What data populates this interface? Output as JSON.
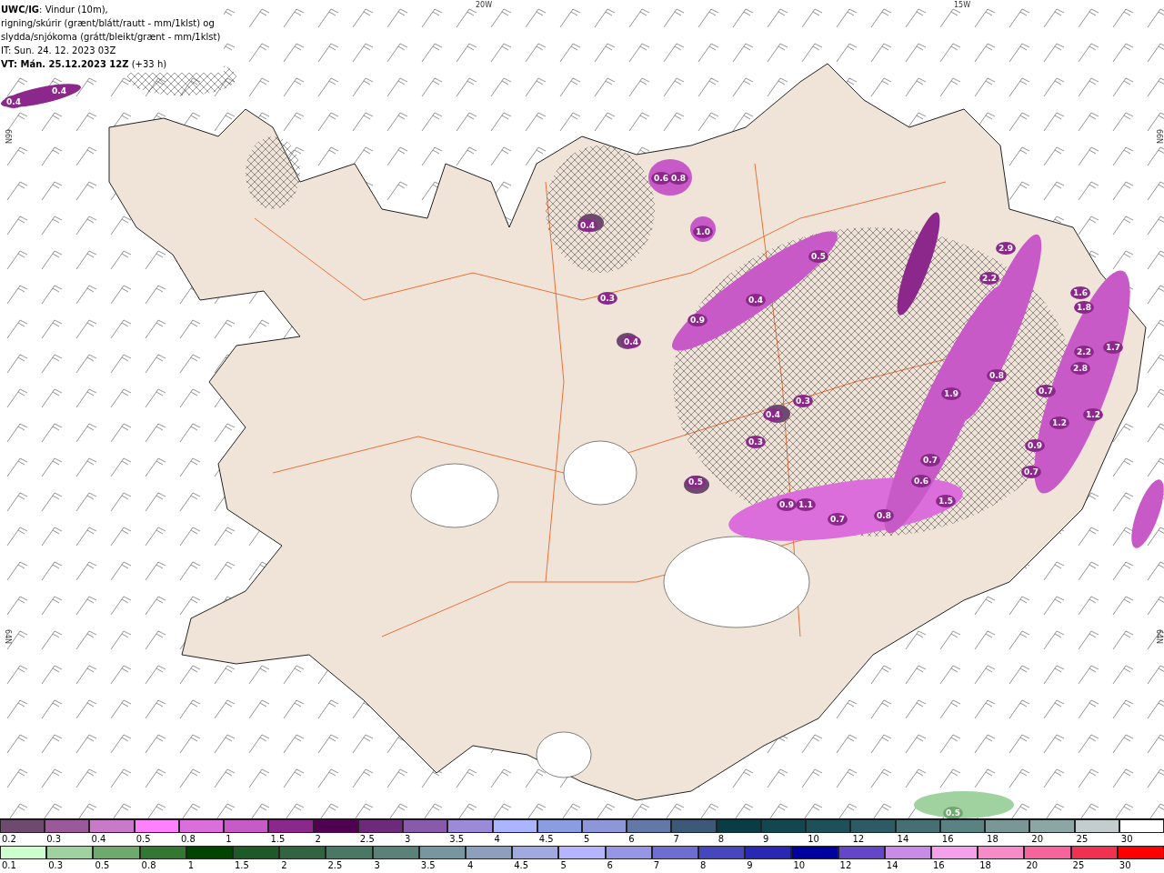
{
  "header": {
    "lines": [
      "**UWC/IG**: Vindur (10m),",
      "rigning/skúrir (grænt/blátt/rautt - mm/1klst) og",
      "slydda/snjókoma (grátt/bleikt/grænt - mm/1klst)",
      "IT: Sun. 24. 12. 2023 03Z",
      "**VT: Mán. 25.12.2023 12Z** (+33 h)"
    ]
  },
  "map": {
    "grid_labels": [
      "20W",
      "15W",
      "66N",
      "66N",
      "64N",
      "64N"
    ],
    "value_labels": [
      "0.4",
      "0.4",
      "0.6",
      "0.8",
      "1.0",
      "0.4",
      "0.3",
      "0.9",
      "0.4",
      "0.5",
      "0.4",
      "0.3",
      "0.4",
      "0.3",
      "0.5",
      "0.9",
      "1.1",
      "0.7",
      "0.8",
      "0.6",
      "0.7",
      "1.5",
      "1.9",
      "0.8",
      "2.2",
      "2.9",
      "1.6",
      "1.8",
      "2.2",
      "2.8",
      "1.7",
      "1.2",
      "1.2",
      "0.7",
      "0.9",
      "0.7",
      "0.5"
    ]
  },
  "legend": {
    "upper_scale": [
      {
        "label": "0.2",
        "color": "#6e4a6e"
      },
      {
        "label": "0.3",
        "color": "#9a5a9a"
      },
      {
        "label": "0.4",
        "color": "#c87ac8"
      },
      {
        "label": "0.5",
        "color": "#ff80ff"
      },
      {
        "label": "0.8",
        "color": "#dc6edc"
      },
      {
        "label": "1",
        "color": "#c85ac8"
      },
      {
        "label": "1.5",
        "color": "#8c288c"
      },
      {
        "label": "2",
        "color": "#500050"
      },
      {
        "label": "2.5",
        "color": "#6e2a7a"
      },
      {
        "label": "3",
        "color": "#8a5aaa"
      },
      {
        "label": "3.5",
        "color": "#9a8ad8"
      },
      {
        "label": "4",
        "color": "#aab4ff"
      },
      {
        "label": "4.5",
        "color": "#8c9ce0"
      },
      {
        "label": "5",
        "color": "#8c96d8"
      },
      {
        "label": "6",
        "color": "#6478a8"
      },
      {
        "label": "7",
        "color": "#3c5a78"
      },
      {
        "label": "8",
        "color": "#0a3c46"
      },
      {
        "label": "9",
        "color": "#144650"
      },
      {
        "label": "10",
        "color": "#1e505a"
      },
      {
        "label": "12",
        "color": "#2d5a64"
      },
      {
        "label": "14",
        "color": "#466e73"
      },
      {
        "label": "16",
        "color": "#5a8282"
      },
      {
        "label": "18",
        "color": "#7a9696"
      },
      {
        "label": "20",
        "color": "#8ca5a5"
      },
      {
        "label": "25",
        "color": "#c3cdcd"
      },
      {
        "label": "30",
        "color": "#ffffff"
      }
    ],
    "lower_scale": [
      {
        "label": "0.1",
        "color": "#cdffcd"
      },
      {
        "label": "0.3",
        "color": "#a0d2a0"
      },
      {
        "label": "0.5",
        "color": "#6eaa6e"
      },
      {
        "label": "0.8",
        "color": "#327832"
      },
      {
        "label": "1",
        "color": "#004600"
      },
      {
        "label": "1.5",
        "color": "#1e5a28"
      },
      {
        "label": "2",
        "color": "#326440"
      },
      {
        "label": "2.5",
        "color": "#4b7864"
      },
      {
        "label": "3",
        "color": "#5a8278"
      },
      {
        "label": "3.5",
        "color": "#7896a0"
      },
      {
        "label": "4",
        "color": "#8ca0be"
      },
      {
        "label": "4.5",
        "color": "#a0aae0"
      },
      {
        "label": "5",
        "color": "#b4b4ff"
      },
      {
        "label": "6",
        "color": "#9696e6"
      },
      {
        "label": "7",
        "color": "#6e6ed2"
      },
      {
        "label": "8",
        "color": "#4646be"
      },
      {
        "label": "9",
        "color": "#2828b4"
      },
      {
        "label": "10",
        "color": "#0000a0"
      },
      {
        "label": "12",
        "color": "#6446c8"
      },
      {
        "label": "14",
        "color": "#c88ce6"
      },
      {
        "label": "16",
        "color": "#f5a0eb"
      },
      {
        "label": "18",
        "color": "#f58cc8"
      },
      {
        "label": "20",
        "color": "#f5649b"
      },
      {
        "label": "25",
        "color": "#f03250"
      },
      {
        "label": "30",
        "color": "#ff0000"
      }
    ]
  }
}
